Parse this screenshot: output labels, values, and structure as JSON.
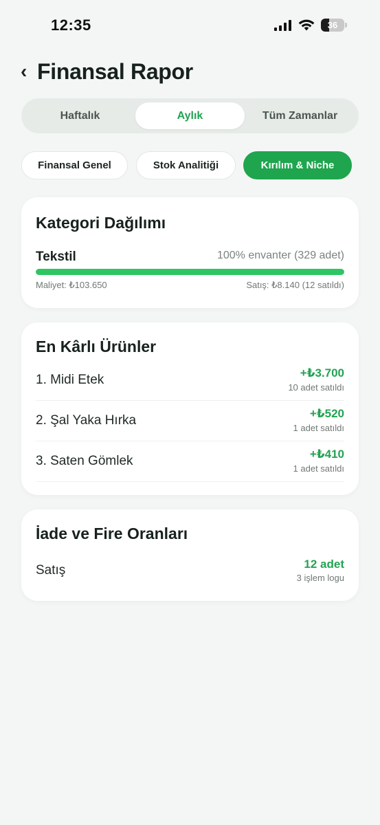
{
  "status_bar": {
    "time": "12:35",
    "battery": "36",
    "battery_level": 0.36
  },
  "header": {
    "title": "Finansal Rapor",
    "back_icon": "‹"
  },
  "period_tabs": [
    {
      "label": "Haftalık",
      "active": false
    },
    {
      "label": "Aylık",
      "active": true
    },
    {
      "label": "Tüm Zamanlar",
      "active": false
    }
  ],
  "view_chips": [
    {
      "label": "Finansal Genel",
      "active": false
    },
    {
      "label": "Stok Analitiği",
      "active": false
    },
    {
      "label": "Kırılım & Niche",
      "active": true
    }
  ],
  "category_card": {
    "title": "Kategori Dağılımı",
    "category": "Tekstil",
    "stock": "100% envanter (329 adet)",
    "share": 1.0,
    "cost": "Maliyet: ₺103.650",
    "sales": "Satış: ₺8.140 (12 satıldı)"
  },
  "top_products_card": {
    "title": "En Kârlı Ürünler",
    "items": [
      {
        "name": "1. Midi Etek",
        "profit": "+₺3.700",
        "sold": "10 adet satıldı"
      },
      {
        "name": "2. Şal Yaka Hırka",
        "profit": "+₺520",
        "sold": "1 adet satıldı"
      },
      {
        "name": "3. Saten Gömlek",
        "profit": "+₺410",
        "sold": "1 adet satıldı"
      }
    ]
  },
  "returns_card": {
    "title": "İade ve Fire Oranları",
    "label": "Satış",
    "value": "12 adet",
    "sub": "3 işlem logu"
  },
  "colors": {
    "accent": "#22a352",
    "accent_dark": "#1ea54e",
    "bar": "#2ec563",
    "background": "#f4f6f5"
  }
}
